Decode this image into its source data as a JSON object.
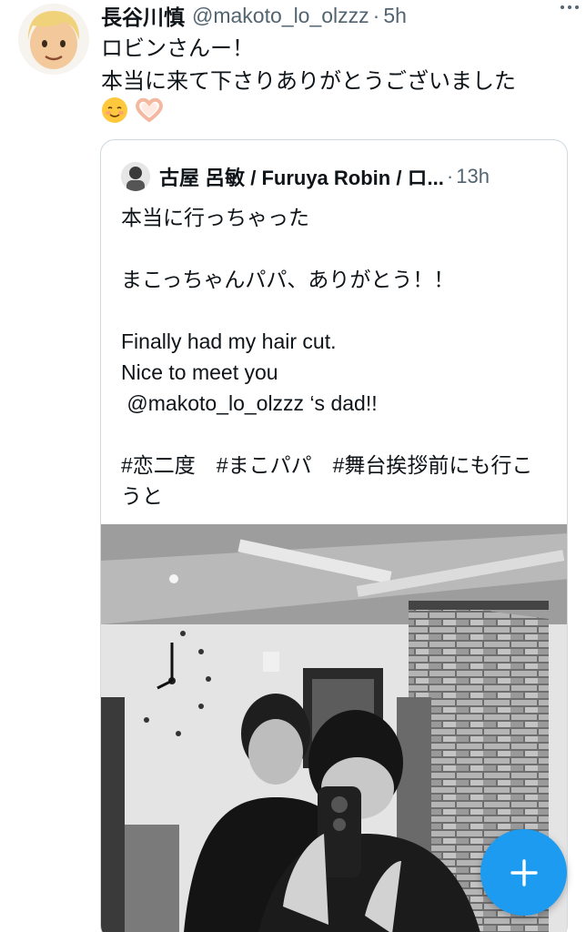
{
  "tweet": {
    "display_name": "長谷川慎",
    "handle": "@makoto_lo_olzzz",
    "time": "5h",
    "text": "ロビンさんー！\n本当に来て下さりありがとうございました",
    "emojis": [
      "smiling-face-emoji",
      "heart-hands-emoji"
    ]
  },
  "quote": {
    "display_name": "古屋 呂敏 / Furuya Robin / ロ...",
    "time": "13h",
    "text": "本当に行っちゃった\n\nまこっちゃんパパ、ありがとう！！\n\nFinally had my hair cut.\nNice to meet you\n @makoto_lo_olzzz ‘s dad!!\n\n#恋二度　#まこパパ　#舞台挨拶前にも行こうと"
  },
  "fab": {
    "icon": "plus-icon",
    "color": "#1d9bf0"
  },
  "colors": {
    "text": "#0f1419",
    "secondary": "#536471",
    "border": "#cfd9de",
    "accent": "#1d9bf0"
  }
}
